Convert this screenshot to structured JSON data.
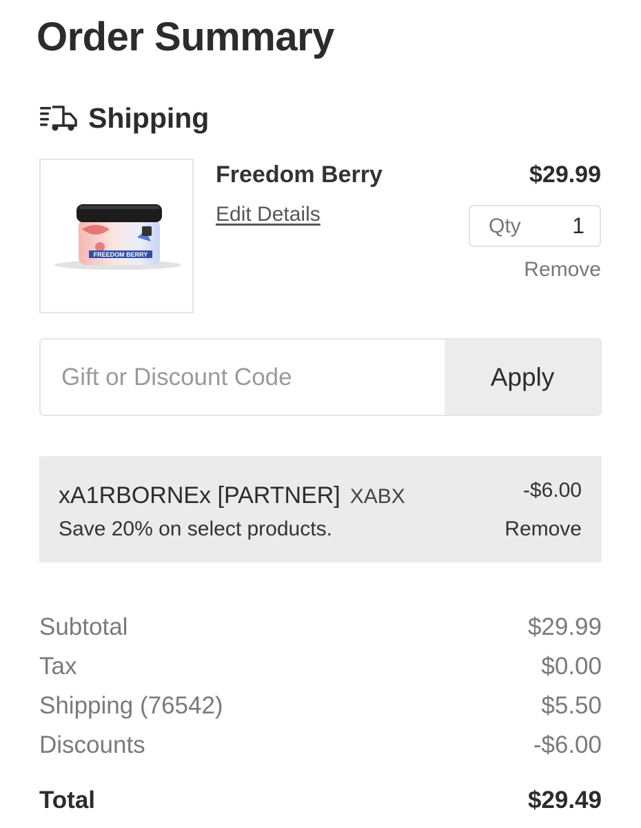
{
  "page": {
    "title": "Order Summary"
  },
  "shipping_section": {
    "icon": "truck-icon",
    "label": "Shipping"
  },
  "cart_item": {
    "name": "Freedom Berry",
    "edit_label": "Edit Details",
    "price": "$29.99",
    "qty_label": "Qty",
    "qty_value": "1",
    "remove_label": "Remove",
    "image_text": "FREEDOM BERRY"
  },
  "discount_form": {
    "placeholder": "Gift or Discount Code",
    "apply_label": "Apply"
  },
  "applied_discount": {
    "name": "xA1RBORNEx [PARTNER]",
    "code": "XABX",
    "description": "Save 20% on select products.",
    "amount": "-$6.00",
    "remove_label": "Remove"
  },
  "totals": {
    "subtotal_label": "Subtotal",
    "subtotal_value": "$29.99",
    "tax_label": "Tax",
    "tax_value": "$0.00",
    "shipping_label": "Shipping (76542)",
    "shipping_value": "$5.50",
    "discounts_label": "Discounts",
    "discounts_value": "-$6.00",
    "total_label": "Total",
    "total_value": "$29.49"
  },
  "colors": {
    "text_primary": "#2c2c2c",
    "text_muted": "#7a7a7a",
    "panel_bg": "#ebebeb",
    "border": "#e6e6e6"
  }
}
